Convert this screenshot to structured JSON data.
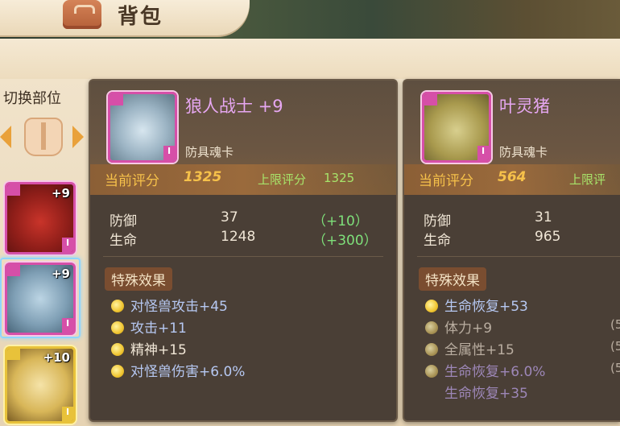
{
  "header": {
    "title": "背包"
  },
  "left": {
    "switch_label": "切换部位",
    "cards": [
      {
        "level": "+9",
        "badge": "I"
      },
      {
        "level": "+9",
        "badge": "I"
      },
      {
        "level": "+10",
        "badge": "I"
      }
    ]
  },
  "panel1": {
    "name": "狼人战士 +9",
    "type": "防具魂卡",
    "badge": "I",
    "current_label": "当前评分",
    "current_value": "1325",
    "max_label": "上限评分",
    "max_value": "1325",
    "stats": [
      {
        "label": "防御",
        "value": "37",
        "bonus": "（+10）"
      },
      {
        "label": "生命",
        "value": "1248",
        "bonus": "（+300）"
      }
    ],
    "effects_title": "特殊效果",
    "effects": [
      {
        "text": "对怪兽攻击+45"
      },
      {
        "text": "攻击+11"
      },
      {
        "text": "精神+15"
      },
      {
        "text": "对怪兽伤害+6.0%"
      }
    ]
  },
  "panel2": {
    "name": "叶灵猪",
    "type": "防具魂卡",
    "badge": "I",
    "current_label": "当前评分",
    "current_value": "564",
    "max_label": "上限评",
    "stats": [
      {
        "label": "防御",
        "value": "31"
      },
      {
        "label": "生命",
        "value": "965"
      }
    ],
    "effects_title": "特殊效果",
    "effects": [
      {
        "text": "生命恢复+53"
      },
      {
        "text": "体力+9",
        "note": "(5"
      },
      {
        "text": "全属性+15",
        "note": "(5"
      },
      {
        "text": "生命恢复+6.0%",
        "note": "(5"
      },
      {
        "text": "生命恢复+35"
      }
    ]
  }
}
